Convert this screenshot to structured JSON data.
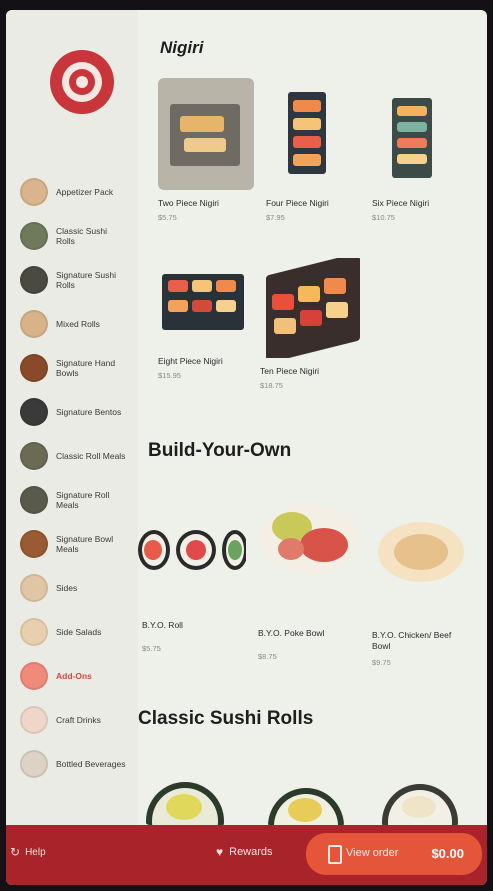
{
  "sidebar": {
    "items": [
      {
        "label": "Appetizer Pack",
        "active": false,
        "color": "#d9b48d"
      },
      {
        "label": "Classic Sushi Rolls",
        "active": false,
        "color": "#6e7a5b"
      },
      {
        "label": "Signature Sushi Rolls",
        "active": false,
        "color": "#4a4a40"
      },
      {
        "label": "Mixed Rolls",
        "active": false,
        "color": "#d8b38a"
      },
      {
        "label": "Signature Hand Bowls",
        "active": false,
        "color": "#8a4a2a"
      },
      {
        "label": "Signature Bentos",
        "active": false,
        "color": "#3a3a3a"
      },
      {
        "label": "Classic Roll Meals",
        "active": false,
        "color": "#6a6a55"
      },
      {
        "label": "Signature Roll Meals",
        "active": false,
        "color": "#5a5a4c"
      },
      {
        "label": "Signature Bowl Meals",
        "active": false,
        "color": "#9a5a34"
      },
      {
        "label": "Sides",
        "active": false,
        "color": "#e0c6a4"
      },
      {
        "label": "Side Salads",
        "active": false,
        "color": "#e8cfb0"
      },
      {
        "label": "Add-Ons",
        "active": true,
        "color": "#f08a7a"
      },
      {
        "label": "Craft Drinks",
        "active": false,
        "color": "#f0d6c8"
      },
      {
        "label": "Bottled Beverages",
        "active": false,
        "color": "#dcd2c6"
      }
    ]
  },
  "sections": {
    "nigiri": {
      "title": "Nigiri",
      "items": [
        {
          "name": "Two Piece Nigiri",
          "price": "$5.75"
        },
        {
          "name": "Four Piece Nigiri",
          "price": "$7.95"
        },
        {
          "name": "Six Piece Nigiri",
          "price": "$10.75"
        },
        {
          "name": "Eight Piece Nigiri",
          "price": "$15.95"
        },
        {
          "name": "Ten Piece Nigiri",
          "price": "$18.75"
        }
      ]
    },
    "byo": {
      "title": "Build-Your-Own",
      "items": [
        {
          "name": "B.Y.O. Roll",
          "price": "$5.75"
        },
        {
          "name": "B.Y.O. Poke Bowl",
          "price": "$8.75"
        },
        {
          "name": "B.Y.O. Chicken/ Beef Bowl",
          "price": "$9.75"
        }
      ]
    },
    "classic_rolls": {
      "title": "Classic Sushi Rolls"
    }
  },
  "bottom_bar": {
    "help_label": "Help",
    "rewards_label": "Rewards",
    "view_order_label": "View order",
    "total": "$0.00"
  },
  "colors": {
    "brand_red": "#a8232a",
    "accent_orange": "#e4553a"
  }
}
